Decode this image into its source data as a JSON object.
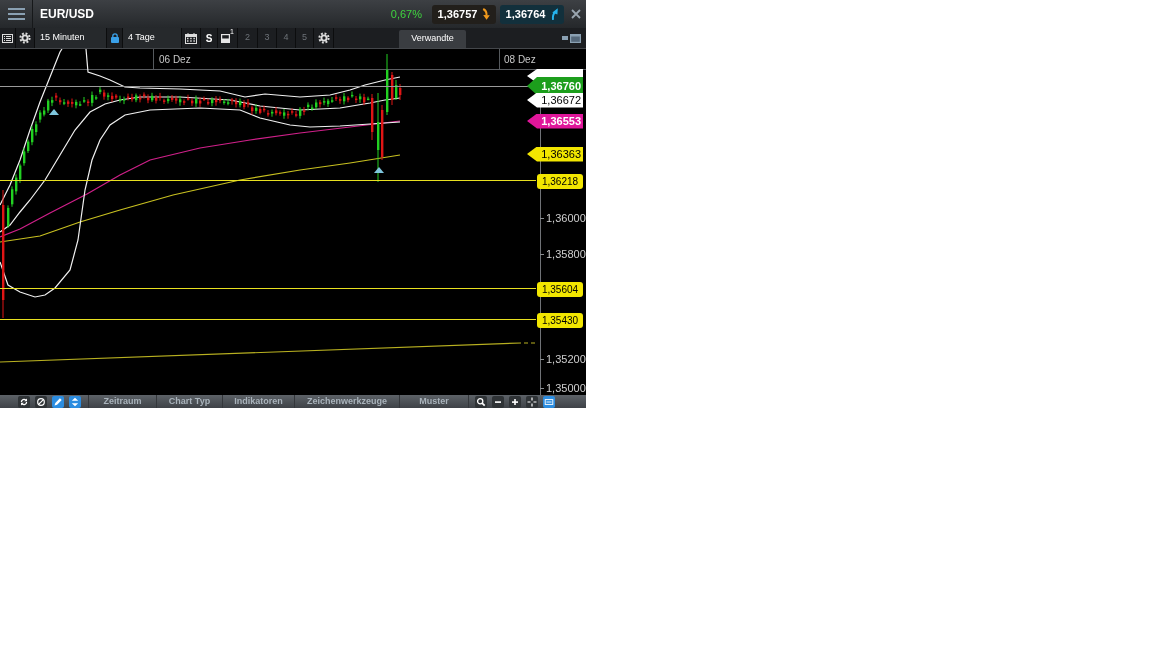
{
  "header": {
    "title": "EUR/USD",
    "change": "0,67%",
    "sell_price": "1,36757",
    "buy_price": "1,36764"
  },
  "toolbar": {
    "interval": "15 Minuten",
    "range": "4 Tage",
    "style": "S",
    "layouts": [
      {
        "label": "1",
        "selected": true
      },
      {
        "label": "2",
        "selected": false
      },
      {
        "label": "3",
        "selected": false
      },
      {
        "label": "4",
        "selected": false
      },
      {
        "label": "5",
        "selected": false
      }
    ],
    "related_tab": "Verwandte"
  },
  "chart": {
    "date_labels": [
      "06 Dez",
      "08 Dez"
    ],
    "axis_labels": [
      "1,36000",
      "1,35800",
      "1,35200",
      "1,35000"
    ],
    "price_flags": [
      {
        "label": "1,36760",
        "color": "#1c9e1c",
        "kind": "pointer"
      },
      {
        "label": "1,36672",
        "color": "#ffffff",
        "kind": "pointer"
      },
      {
        "label": "1,36553",
        "color": "#e0169a",
        "kind": "pointer"
      },
      {
        "label": "1,36363",
        "color": "#f2e600",
        "kind": "pointer"
      },
      {
        "label": "1,36218",
        "color": "#f2e600",
        "kind": "box"
      },
      {
        "label": "1,35604",
        "color": "#f2e600",
        "kind": "box"
      },
      {
        "label": "1,35430",
        "color": "#f2e600",
        "kind": "box"
      }
    ]
  },
  "bottom_bar": {
    "left_tools": [
      {
        "kind": "refresh",
        "on": false
      },
      {
        "kind": "cancel",
        "on": false
      },
      {
        "kind": "pencil",
        "on": true
      },
      {
        "kind": "updown",
        "on": true
      }
    ],
    "tabs": [
      "Zeitraum",
      "Chart Typ",
      "Indikatoren",
      "Zeichenwerkzeuge",
      "Muster"
    ],
    "right_tools": [
      {
        "kind": "search",
        "on": false
      },
      {
        "kind": "minus",
        "on": false
      },
      {
        "kind": "plus",
        "on": false
      },
      {
        "kind": "crosshair",
        "on": false
      },
      {
        "kind": "panel",
        "on": true
      }
    ]
  }
}
